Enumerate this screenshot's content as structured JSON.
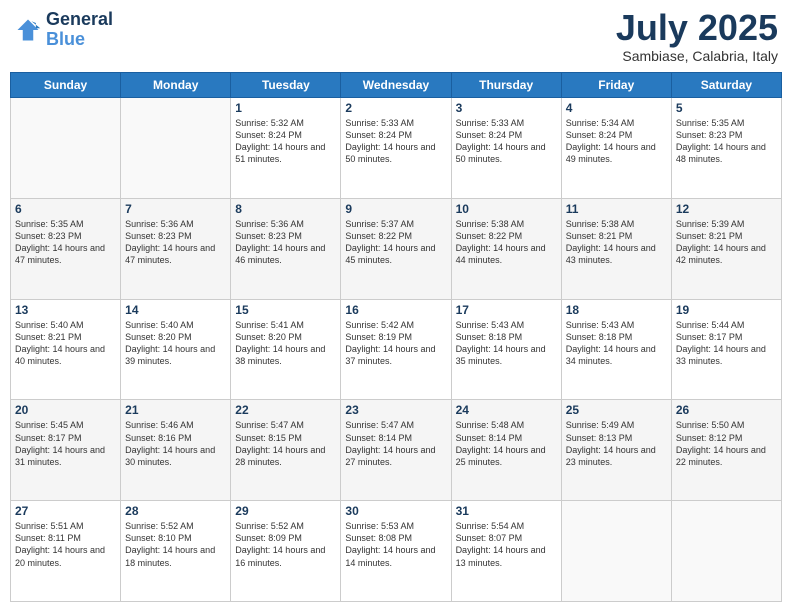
{
  "header": {
    "logo_line1": "General",
    "logo_line2": "Blue",
    "month": "July 2025",
    "location": "Sambiase, Calabria, Italy"
  },
  "days_of_week": [
    "Sunday",
    "Monday",
    "Tuesday",
    "Wednesday",
    "Thursday",
    "Friday",
    "Saturday"
  ],
  "weeks": [
    [
      {
        "day": "",
        "sunrise": "",
        "sunset": "",
        "daylight": ""
      },
      {
        "day": "",
        "sunrise": "",
        "sunset": "",
        "daylight": ""
      },
      {
        "day": "1",
        "sunrise": "Sunrise: 5:32 AM",
        "sunset": "Sunset: 8:24 PM",
        "daylight": "Daylight: 14 hours and 51 minutes."
      },
      {
        "day": "2",
        "sunrise": "Sunrise: 5:33 AM",
        "sunset": "Sunset: 8:24 PM",
        "daylight": "Daylight: 14 hours and 50 minutes."
      },
      {
        "day": "3",
        "sunrise": "Sunrise: 5:33 AM",
        "sunset": "Sunset: 8:24 PM",
        "daylight": "Daylight: 14 hours and 50 minutes."
      },
      {
        "day": "4",
        "sunrise": "Sunrise: 5:34 AM",
        "sunset": "Sunset: 8:24 PM",
        "daylight": "Daylight: 14 hours and 49 minutes."
      },
      {
        "day": "5",
        "sunrise": "Sunrise: 5:35 AM",
        "sunset": "Sunset: 8:23 PM",
        "daylight": "Daylight: 14 hours and 48 minutes."
      }
    ],
    [
      {
        "day": "6",
        "sunrise": "Sunrise: 5:35 AM",
        "sunset": "Sunset: 8:23 PM",
        "daylight": "Daylight: 14 hours and 47 minutes."
      },
      {
        "day": "7",
        "sunrise": "Sunrise: 5:36 AM",
        "sunset": "Sunset: 8:23 PM",
        "daylight": "Daylight: 14 hours and 47 minutes."
      },
      {
        "day": "8",
        "sunrise": "Sunrise: 5:36 AM",
        "sunset": "Sunset: 8:23 PM",
        "daylight": "Daylight: 14 hours and 46 minutes."
      },
      {
        "day": "9",
        "sunrise": "Sunrise: 5:37 AM",
        "sunset": "Sunset: 8:22 PM",
        "daylight": "Daylight: 14 hours and 45 minutes."
      },
      {
        "day": "10",
        "sunrise": "Sunrise: 5:38 AM",
        "sunset": "Sunset: 8:22 PM",
        "daylight": "Daylight: 14 hours and 44 minutes."
      },
      {
        "day": "11",
        "sunrise": "Sunrise: 5:38 AM",
        "sunset": "Sunset: 8:21 PM",
        "daylight": "Daylight: 14 hours and 43 minutes."
      },
      {
        "day": "12",
        "sunrise": "Sunrise: 5:39 AM",
        "sunset": "Sunset: 8:21 PM",
        "daylight": "Daylight: 14 hours and 42 minutes."
      }
    ],
    [
      {
        "day": "13",
        "sunrise": "Sunrise: 5:40 AM",
        "sunset": "Sunset: 8:21 PM",
        "daylight": "Daylight: 14 hours and 40 minutes."
      },
      {
        "day": "14",
        "sunrise": "Sunrise: 5:40 AM",
        "sunset": "Sunset: 8:20 PM",
        "daylight": "Daylight: 14 hours and 39 minutes."
      },
      {
        "day": "15",
        "sunrise": "Sunrise: 5:41 AM",
        "sunset": "Sunset: 8:20 PM",
        "daylight": "Daylight: 14 hours and 38 minutes."
      },
      {
        "day": "16",
        "sunrise": "Sunrise: 5:42 AM",
        "sunset": "Sunset: 8:19 PM",
        "daylight": "Daylight: 14 hours and 37 minutes."
      },
      {
        "day": "17",
        "sunrise": "Sunrise: 5:43 AM",
        "sunset": "Sunset: 8:18 PM",
        "daylight": "Daylight: 14 hours and 35 minutes."
      },
      {
        "day": "18",
        "sunrise": "Sunrise: 5:43 AM",
        "sunset": "Sunset: 8:18 PM",
        "daylight": "Daylight: 14 hours and 34 minutes."
      },
      {
        "day": "19",
        "sunrise": "Sunrise: 5:44 AM",
        "sunset": "Sunset: 8:17 PM",
        "daylight": "Daylight: 14 hours and 33 minutes."
      }
    ],
    [
      {
        "day": "20",
        "sunrise": "Sunrise: 5:45 AM",
        "sunset": "Sunset: 8:17 PM",
        "daylight": "Daylight: 14 hours and 31 minutes."
      },
      {
        "day": "21",
        "sunrise": "Sunrise: 5:46 AM",
        "sunset": "Sunset: 8:16 PM",
        "daylight": "Daylight: 14 hours and 30 minutes."
      },
      {
        "day": "22",
        "sunrise": "Sunrise: 5:47 AM",
        "sunset": "Sunset: 8:15 PM",
        "daylight": "Daylight: 14 hours and 28 minutes."
      },
      {
        "day": "23",
        "sunrise": "Sunrise: 5:47 AM",
        "sunset": "Sunset: 8:14 PM",
        "daylight": "Daylight: 14 hours and 27 minutes."
      },
      {
        "day": "24",
        "sunrise": "Sunrise: 5:48 AM",
        "sunset": "Sunset: 8:14 PM",
        "daylight": "Daylight: 14 hours and 25 minutes."
      },
      {
        "day": "25",
        "sunrise": "Sunrise: 5:49 AM",
        "sunset": "Sunset: 8:13 PM",
        "daylight": "Daylight: 14 hours and 23 minutes."
      },
      {
        "day": "26",
        "sunrise": "Sunrise: 5:50 AM",
        "sunset": "Sunset: 8:12 PM",
        "daylight": "Daylight: 14 hours and 22 minutes."
      }
    ],
    [
      {
        "day": "27",
        "sunrise": "Sunrise: 5:51 AM",
        "sunset": "Sunset: 8:11 PM",
        "daylight": "Daylight: 14 hours and 20 minutes."
      },
      {
        "day": "28",
        "sunrise": "Sunrise: 5:52 AM",
        "sunset": "Sunset: 8:10 PM",
        "daylight": "Daylight: 14 hours and 18 minutes."
      },
      {
        "day": "29",
        "sunrise": "Sunrise: 5:52 AM",
        "sunset": "Sunset: 8:09 PM",
        "daylight": "Daylight: 14 hours and 16 minutes."
      },
      {
        "day": "30",
        "sunrise": "Sunrise: 5:53 AM",
        "sunset": "Sunset: 8:08 PM",
        "daylight": "Daylight: 14 hours and 14 minutes."
      },
      {
        "day": "31",
        "sunrise": "Sunrise: 5:54 AM",
        "sunset": "Sunset: 8:07 PM",
        "daylight": "Daylight: 14 hours and 13 minutes."
      },
      {
        "day": "",
        "sunrise": "",
        "sunset": "",
        "daylight": ""
      },
      {
        "day": "",
        "sunrise": "",
        "sunset": "",
        "daylight": ""
      }
    ]
  ]
}
